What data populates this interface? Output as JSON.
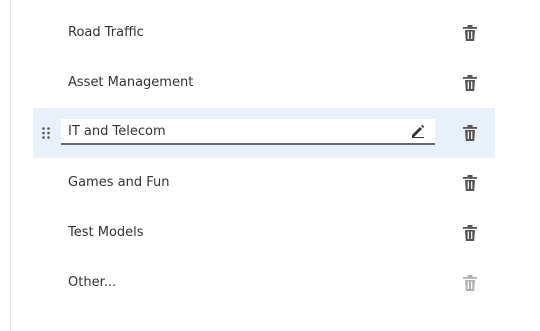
{
  "categories": [
    {
      "label": "Road Traffic",
      "delete_icon": "trash-icon"
    },
    {
      "label": "Asset Management",
      "delete_icon": "trash-icon"
    },
    {
      "label": "IT and Telecom",
      "delete_icon": "trash-icon",
      "editing": true,
      "edit_icon": "pencil-icon",
      "drag_icon": "drag-handle-icon"
    },
    {
      "label": "Games and Fun",
      "delete_icon": "trash-icon"
    },
    {
      "label": "Test Models",
      "delete_icon": "trash-icon"
    },
    {
      "label": "Other...",
      "delete_icon": "trash-icon",
      "delete_disabled": true
    }
  ],
  "colors": {
    "selected_row": "#e8f1f9",
    "text": "#333333",
    "icon": "#555555"
  }
}
